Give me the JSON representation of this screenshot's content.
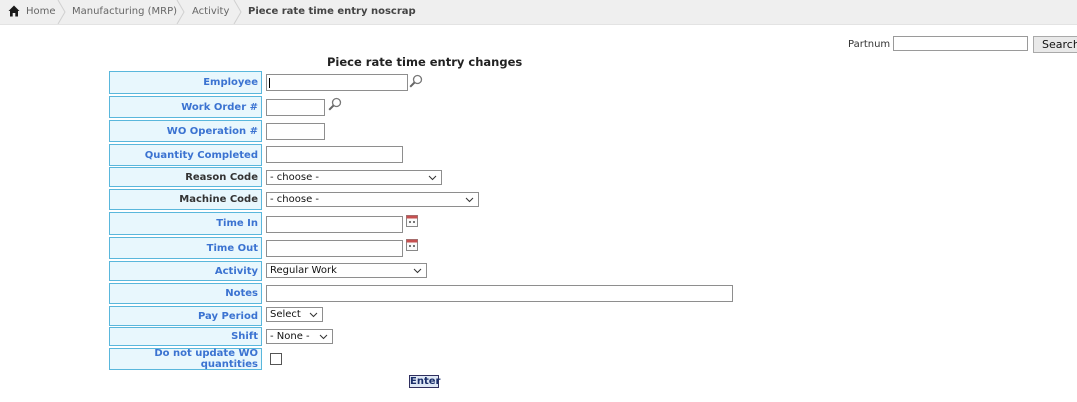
{
  "breadcrumb": {
    "items": [
      "Home",
      "Manufacturing (MRP)",
      "Activity",
      "Piece rate time entry noscrap"
    ]
  },
  "search": {
    "label": "Partnum",
    "value": "",
    "button": "Search"
  },
  "form": {
    "title": "Piece rate time entry changes",
    "employee": {
      "label": "Employee",
      "value": ""
    },
    "work_order": {
      "label": "Work Order #",
      "value": ""
    },
    "wo_operation": {
      "label": "WO Operation #",
      "value": ""
    },
    "quantity_completed": {
      "label": "Quantity Completed",
      "value": ""
    },
    "reason_code": {
      "label": "Reason Code",
      "selected": "- choose -"
    },
    "machine_code": {
      "label": "Machine Code",
      "selected": "- choose -"
    },
    "time_in": {
      "label": "Time In",
      "value": ""
    },
    "time_out": {
      "label": "Time Out",
      "value": ""
    },
    "activity": {
      "label": "Activity",
      "selected": "Regular Work"
    },
    "notes": {
      "label": "Notes",
      "value": ""
    },
    "pay_period": {
      "label": "Pay Period",
      "selected": "Select"
    },
    "shift": {
      "label": "Shift",
      "selected": "- None -"
    },
    "do_not_update": {
      "label": "Do not update WO quantities",
      "checked": false
    },
    "submit_label": "Enter"
  }
}
